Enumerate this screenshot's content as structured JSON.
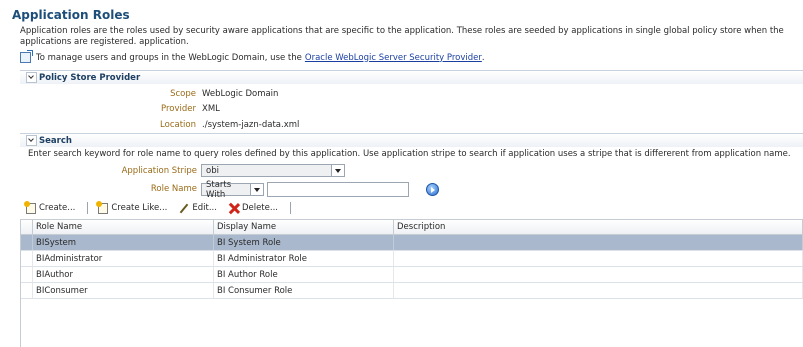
{
  "page": {
    "title": "Application Roles",
    "description": "Application roles are the roles used by security aware applications that are specific to the application. These roles are seeded by applications in single global policy store when the applications are registered. application.",
    "manage_prefix": "To manage users and groups in the WebLogic Domain, use the",
    "manage_link": "Oracle WebLogic Server Security Provider",
    "manage_suffix": "."
  },
  "policy_store": {
    "header": "Policy Store Provider",
    "fields": [
      {
        "label": "Scope",
        "value": "WebLogic Domain"
      },
      {
        "label": "Provider",
        "value": "XML"
      },
      {
        "label": "Location",
        "value": "./system-jazn-data.xml"
      }
    ]
  },
  "search": {
    "header": "Search",
    "note": "Enter search keyword for role name to query roles defined by this application. Use application stripe to search if application uses a stripe that is differerent from application name.",
    "stripe_label": "Application Stripe",
    "stripe_value": "obi",
    "role_label": "Role Name",
    "role_operator": "Starts With",
    "role_value": ""
  },
  "toolbar": {
    "create": "Create...",
    "create_like": "Create Like...",
    "edit": "Edit...",
    "delete": "Delete..."
  },
  "table": {
    "columns": [
      "Role Name",
      "Display Name",
      "Description"
    ],
    "rows": [
      {
        "role": "BISystem",
        "display": "BI System Role",
        "description": ""
      },
      {
        "role": "BIAdministrator",
        "display": "BI Administrator Role",
        "description": ""
      },
      {
        "role": "BIAuthor",
        "display": "BI Author Role",
        "description": ""
      },
      {
        "role": "BIConsumer",
        "display": "BI Consumer Role",
        "description": ""
      }
    ]
  },
  "colors": {
    "title": "#1d4e7a",
    "label": "#9a6a17",
    "selected_row": "#a9b8cc",
    "link": "#1a3fa0"
  }
}
